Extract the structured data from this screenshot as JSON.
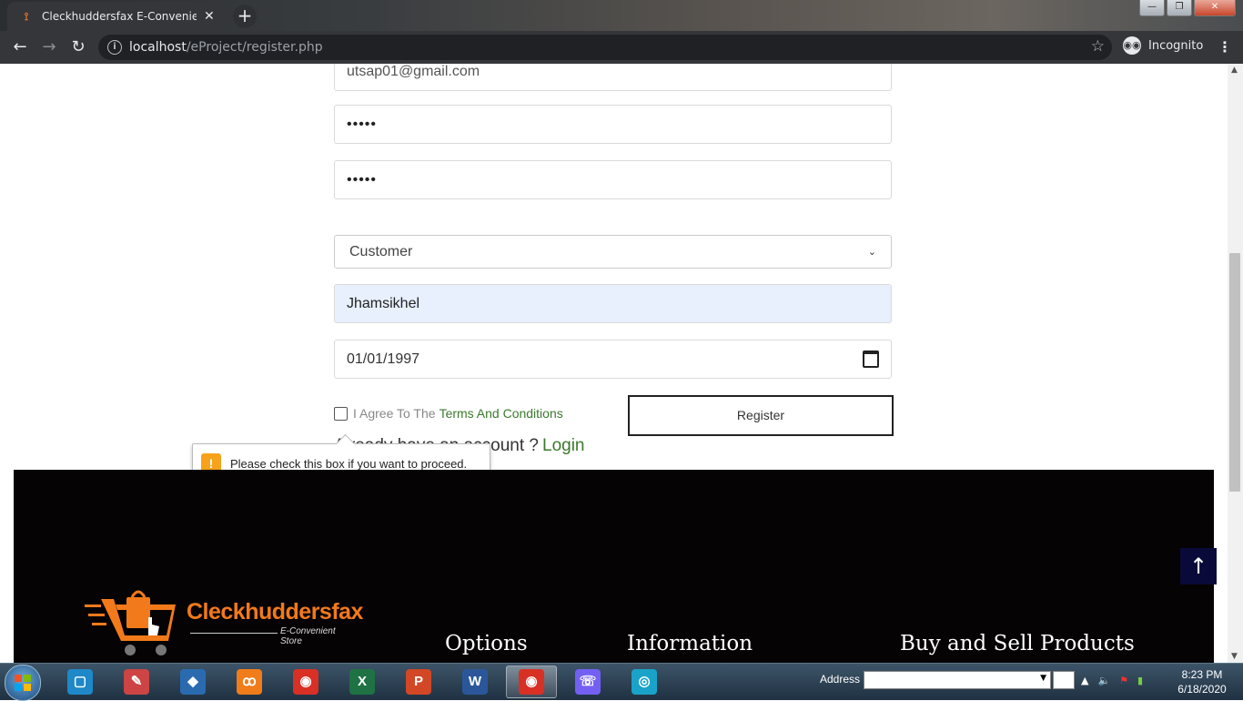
{
  "browser": {
    "tab_title": "Cleckhuddersfax E-Convenient Store",
    "tab_close": "✕",
    "new_tab": "+",
    "url_host": "localhost",
    "url_path": "/eProject/register.php",
    "incognito_label": "Incognito",
    "window_buttons": {
      "minimize": "—",
      "maximize": "❐",
      "close": "✕"
    }
  },
  "form": {
    "email_value": "utsap01@gmail.com",
    "password_value": "•••••",
    "confirm_password_value": "•••••",
    "role_selected": "Customer",
    "address_value": "Jhamsikhel",
    "dob_value": "01/01/1997",
    "agree_text": "I Agree To The",
    "terms_link": "Terms And Conditions",
    "register_label": "Register",
    "already_text": "Already have an account ?",
    "login_link": "Login",
    "validation_message": "Please check this box if you want to proceed."
  },
  "footer": {
    "brand_name": "Cleckhuddersfax",
    "brand_tagline": "E-Convenient Store",
    "headings": [
      "Options",
      "Information",
      "Buy and Sell Products"
    ],
    "back_to_top": "↑"
  },
  "taskbar": {
    "address_label": "Address",
    "time": "8:23 PM",
    "date": "6/18/2020",
    "apps": [
      {
        "name": "file-explorer",
        "glyph": "▢",
        "color": "#1e88c8"
      },
      {
        "name": "paint",
        "glyph": "✎",
        "color": "#c44"
      },
      {
        "name": "virtualbox",
        "glyph": "◆",
        "color": "#2a6bb0"
      },
      {
        "name": "xampp",
        "glyph": "ꝏ",
        "color": "#f07c1a"
      },
      {
        "name": "chrome",
        "glyph": "◉",
        "color": "#d93025"
      },
      {
        "name": "excel",
        "glyph": "X",
        "color": "#1f7244"
      },
      {
        "name": "powerpoint",
        "glyph": "P",
        "color": "#d24726"
      },
      {
        "name": "word",
        "glyph": "W",
        "color": "#2b579a"
      },
      {
        "name": "chrome-active",
        "glyph": "◉",
        "color": "#d93025"
      },
      {
        "name": "viber",
        "glyph": "☏",
        "color": "#7360f2"
      },
      {
        "name": "eye-app",
        "glyph": "◎",
        "color": "#1aa3c8"
      }
    ]
  }
}
